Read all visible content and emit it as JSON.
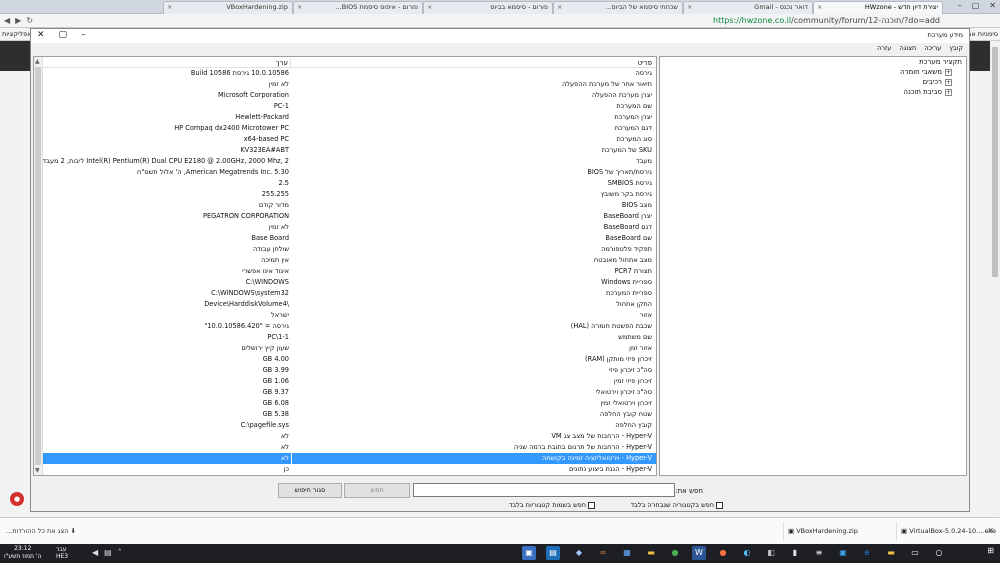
{
  "browser": {
    "tabs": [
      {
        "label": "יצירת דיון חדש - HWzone",
        "active": true
      },
      {
        "label": "דואר נכנס - Gmail"
      },
      {
        "label": "שכחתי סיסמא של הביוס..."
      },
      {
        "label": "פורום - סיסמא בביוס"
      },
      {
        "label": "פורום - איפוס סיסמת BIOS..."
      },
      {
        "label": "VBoxHardening.zip"
      }
    ],
    "url_host": "https://hwzone.co.il",
    "url_path": "/community/forum/12-תוכנה/?do=add",
    "bookmark_left": "אפליקציות",
    "bookmark_right": "סימניות אחרות"
  },
  "window": {
    "title": "מידע מערכת",
    "menu": [
      "קובץ",
      "עריכה",
      "תצוגה",
      "עזרה"
    ],
    "tree": [
      {
        "label": "תקציר מערכת",
        "expand": "",
        "child": false
      },
      {
        "label": "משאבי חומרה",
        "expand": "+",
        "child": true
      },
      {
        "label": "רכיבים",
        "expand": "+",
        "child": true
      },
      {
        "label": "סביבת תוכנה",
        "expand": "+",
        "child": true
      }
    ],
    "columns": {
      "item": "פריט",
      "value": "ערך"
    },
    "rows": [
      {
        "item": "גירסה",
        "value": "10.0.10586 גירסת Build 10586"
      },
      {
        "item": "תיאור אחר של מערכת ההפעלה",
        "value": "לא זמין"
      },
      {
        "item": "יצרן מערכת ההפעלה",
        "value": "Microsoft Corporation"
      },
      {
        "item": "שם המערכת",
        "value": "PC-1"
      },
      {
        "item": "יצרן המערכת",
        "value": "Hewlett-Packard"
      },
      {
        "item": "דגם המערכת",
        "value": "HP Compaq dx2400 Microtower PC"
      },
      {
        "item": "סוג המערכת",
        "value": "x64-based PC"
      },
      {
        "item": "SKU של המערכת",
        "value": "KV323EA#ABT"
      },
      {
        "item": "מעבד",
        "value": "Intel(R) Pentium(R) Dual CPU E2180 @ 2.00GHz, 2000 Mhz, 2 ליבות, 2 מעבדים..."
      },
      {
        "item": "גירסת/תאריך של BIOS",
        "value": "American Megatrends Inc. 5.30, ה' אלול תשס\"ח"
      },
      {
        "item": "גירסת SMBIOS",
        "value": "2.5"
      },
      {
        "item": "גירסת בקר משובץ",
        "value": "255.255"
      },
      {
        "item": "מצב BIOS",
        "value": "מדור קודם"
      },
      {
        "item": "יצרן BaseBoard",
        "value": "PEGATRON CORPORATION"
      },
      {
        "item": "דגם BaseBoard",
        "value": "לא זמין"
      },
      {
        "item": "שם BaseBoard",
        "value": "Base Board"
      },
      {
        "item": "תפקיד פלטפורמה",
        "value": "שולחן עבודה"
      },
      {
        "item": "מצב אתחול מאובטח",
        "value": "אין תמיכה"
      },
      {
        "item": "תצורת PCR7",
        "value": "איגוד אינו אפשרי"
      },
      {
        "item": "ספריית Windows",
        "value": "C:\\WINDOWS"
      },
      {
        "item": "ספריית המערכת",
        "value": "C:\\WINDOWS\\system32"
      },
      {
        "item": "התקן אתחול",
        "value": "\\Device\\HarddiskVolume4"
      },
      {
        "item": "אזור",
        "value": "ישראל"
      },
      {
        "item": "שכבת הפשטת חומרה (HAL)",
        "value": "גירסה = \"10.0.10586.420\""
      },
      {
        "item": "שם משתמש",
        "value": "PC\\1-1"
      },
      {
        "item": "אזור זמן",
        "value": "שעון קיץ ירושלים"
      },
      {
        "item": "זיכרון פיזי מותקן (RAM)",
        "value": "4.00 GB"
      },
      {
        "item": "סה\"כ זיכרון פיזי",
        "value": "3.99 GB"
      },
      {
        "item": "זיכרון פיזי זמין",
        "value": "1.06 GB"
      },
      {
        "item": "סה\"כ זיכרון וירטואלי",
        "value": "9.37 GB"
      },
      {
        "item": "זיכרון וירטואלי זמין",
        "value": "6.08 GB"
      },
      {
        "item": "שטח קובץ החלפה",
        "value": "5.38 GB"
      },
      {
        "item": "קובץ החלפה",
        "value": "C:\\pagefile.sys"
      },
      {
        "item": "Hyper-V - הרחבות של מצב צג VM",
        "value": "לא"
      },
      {
        "item": "Hyper-V - הרחבות של תרגום בתובת ברמה שניה",
        "value": "לא"
      },
      {
        "item": "Hyper-V - וירטואליזציה זמינה בקושחה",
        "value": "לא",
        "selected": true
      },
      {
        "item": "Hyper-V - הגנת ביצוע נתונים",
        "value": "כן"
      }
    ],
    "search": {
      "label": "חפש את:",
      "value": "",
      "find_label": "חפש",
      "close_label": "סגור חיפוש",
      "opt_selected_category": "חפש בקטגוריה שנבחרה בלבד",
      "opt_category_names": "חפש בשמות קטגוריות בלבד"
    }
  },
  "downloads": {
    "show_all": "הצג את כל ההורדות...",
    "items": [
      "VBoxHardening.zip",
      "VirtualBox-5.0.24-10....exe"
    ]
  },
  "taskbar": {
    "time": "23:12",
    "date": "ה' תמוז תשע\"ו",
    "lang": "עבר",
    "lang_sub": "HE3"
  },
  "colors": {
    "selection": "#3399ff",
    "taskbar": "#1e1f24"
  }
}
